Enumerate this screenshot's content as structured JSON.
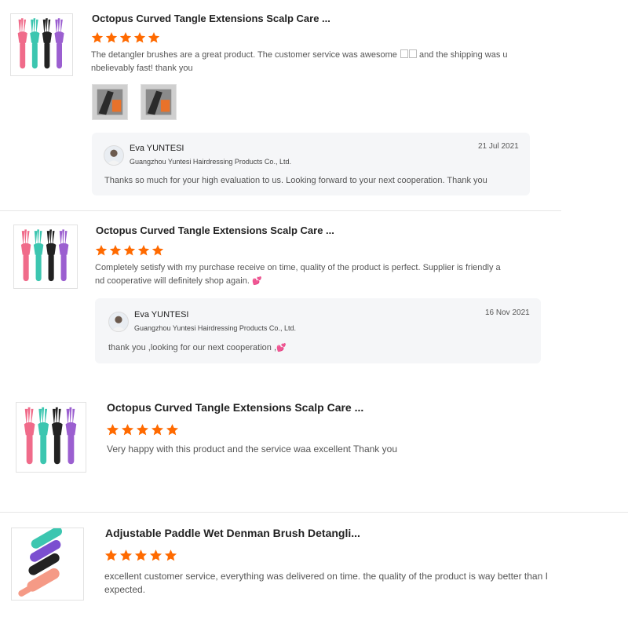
{
  "colors": {
    "star": "#ff6a00",
    "reply_bg": "#f5f6f8",
    "separator": "#e6e6e6"
  },
  "icons": {
    "star": "star-icon",
    "heart": "heart-emoji",
    "heart_glyph": "💕",
    "rating_out_of": 5
  },
  "reviews": [
    {
      "product_title": "Octopus Curved Tangle Extensions Scalp Care ...",
      "rating": 5,
      "text": "The detangler brushes are a great  product. The customer service was awesome",
      "text_emoji": "",
      "text_cont": " and the shipping was u",
      "text_line2": "nbelievably fast! thank you",
      "reply": {
        "name": "Eva YUNTESI",
        "company": "Guangzhou Yuntesi Hairdressing Products Co., Ltd.",
        "date": "21 Jul 2021",
        "text": "Thanks so much for your high evaluation to us.  Looking forward to your next cooperation. Thank you"
      }
    },
    {
      "product_title": "Octopus Curved Tangle Extensions Scalp Care ...",
      "rating": 5,
      "text": "Completely setisfy with my purchase receive on time, quality of the product is perfect. Supplier is friendly a",
      "text_line2": "nd cooperative will definitely shop again. ",
      "reply": {
        "name": "Eva YUNTESI",
        "company": "Guangzhou Yuntesi Hairdressing Products Co., Ltd.",
        "date": "16 Nov 2021",
        "text": "thank you ,looking for our next cooperation ,"
      }
    },
    {
      "product_title": "Octopus Curved Tangle Extensions Scalp Care ...",
      "rating": 5,
      "text": "Very happy with this product and the service waa excellent Thank you"
    },
    {
      "product_title": "Adjustable Paddle Wet Denman Brush Detangli...",
      "rating": 5,
      "text": "excellent customer service, everything was delivered on time. the quality of the product is way better than I",
      "text_line2": "expected."
    }
  ]
}
